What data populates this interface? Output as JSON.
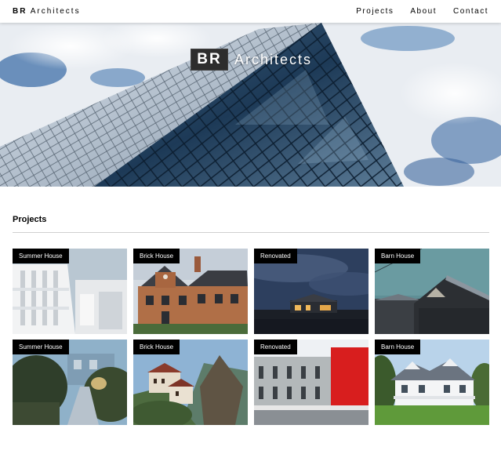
{
  "brand": {
    "bold": "BR",
    "name": "Architects"
  },
  "nav": {
    "projects": "Projects",
    "about": "About",
    "contact": "Contact"
  },
  "hero": {
    "badge": "BR",
    "title": "Architects"
  },
  "projects": {
    "heading": "Projects",
    "cards": [
      {
        "label": "Summer House",
        "scene": "white-modern"
      },
      {
        "label": "Brick House",
        "scene": "brick-manor"
      },
      {
        "label": "Renovated",
        "scene": "night-house"
      },
      {
        "label": "Barn House",
        "scene": "dark-barn"
      },
      {
        "label": "Summer House",
        "scene": "garden-path"
      },
      {
        "label": "Brick House",
        "scene": "cliff-monastery"
      },
      {
        "label": "Renovated",
        "scene": "red-facade"
      },
      {
        "label": "Barn House",
        "scene": "white-villa"
      }
    ]
  }
}
